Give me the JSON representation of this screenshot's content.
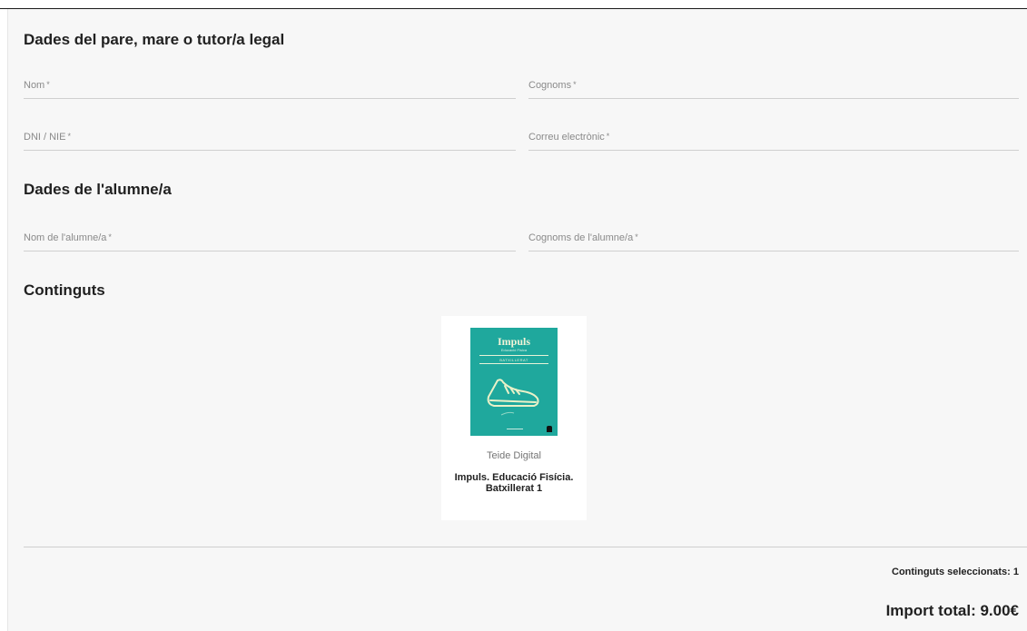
{
  "sections": {
    "parent_heading": "Dades del pare, mare o tutor/a legal",
    "student_heading": "Dades de l'alumne/a",
    "contents_heading": "Continguts"
  },
  "parent_fields": {
    "nom": {
      "label": "Nom",
      "required": "*",
      "value": ""
    },
    "cognoms": {
      "label": "Cognoms",
      "required": "*",
      "value": ""
    },
    "dni": {
      "label": "DNI / NIE",
      "required": "*",
      "value": ""
    },
    "email": {
      "label": "Correu electrònic",
      "required": "*",
      "value": ""
    }
  },
  "student_fields": {
    "nom": {
      "label": "Nom de l'alumne/a",
      "required": "*",
      "value": ""
    },
    "cognoms": {
      "label": "Cognoms de l'alumne/a",
      "required": "*",
      "value": ""
    }
  },
  "products": [
    {
      "cover_title": "Impuls",
      "cover_subtitle": "Educació Física",
      "cover_level": "BATXILLERAT",
      "cover_color": "#1fa89d",
      "cover_icon": "sneaker-icon",
      "publisher": "Teide Digital",
      "title": "Impuls. Educació Fisícia. Batxillerat 1"
    }
  ],
  "summary": {
    "selected_label": "Continguts seleccionats: 1",
    "total_label": "Import total: 9.00€"
  }
}
